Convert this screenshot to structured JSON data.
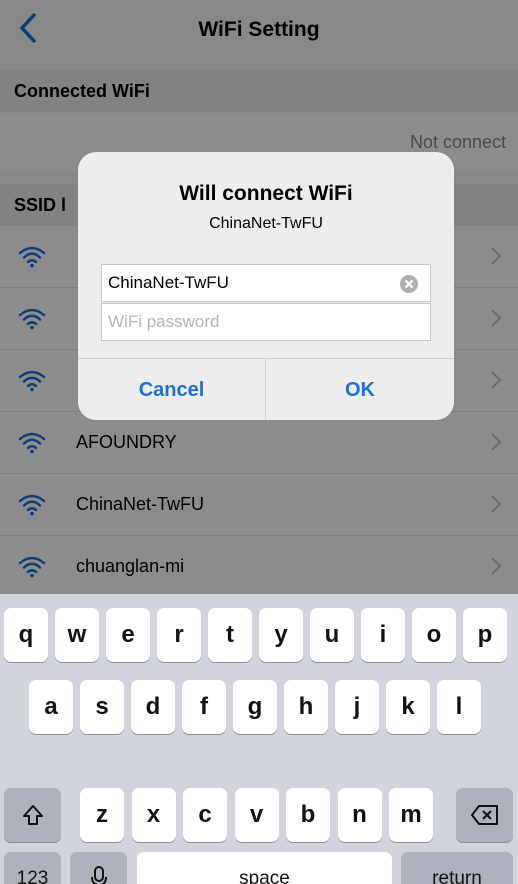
{
  "nav": {
    "title": "WiFi Setting"
  },
  "connected": {
    "header": "Connected WiFi",
    "status": "Not connect"
  },
  "ssid": {
    "header": "SSID l"
  },
  "wifi_list": [
    {
      "name": ""
    },
    {
      "name": ""
    },
    {
      "name": ""
    },
    {
      "name": "AFOUNDRY"
    },
    {
      "name": "ChinaNet-TwFU"
    },
    {
      "name": "chuanglan-mi"
    }
  ],
  "dialog": {
    "title": "Will connect WiFi",
    "subtitle": "ChinaNet-TwFU",
    "ssid_value": "ChinaNet-TwFU",
    "password_placeholder": "WiFi password",
    "cancel_label": "Cancel",
    "ok_label": "OK"
  },
  "keyboard": {
    "row1": [
      "q",
      "w",
      "e",
      "r",
      "t",
      "y",
      "u",
      "i",
      "o",
      "p"
    ],
    "row2": [
      "a",
      "s",
      "d",
      "f",
      "g",
      "h",
      "j",
      "k",
      "l"
    ],
    "row3": [
      "z",
      "x",
      "c",
      "v",
      "b",
      "n",
      "m"
    ],
    "numbers_label": "123",
    "space_label": "space",
    "return_label": "return"
  },
  "colors": {
    "accent": "#1e6fd9",
    "wifi_icon": "#1e6fd9",
    "keyboard_bg": "#d1d4da"
  }
}
